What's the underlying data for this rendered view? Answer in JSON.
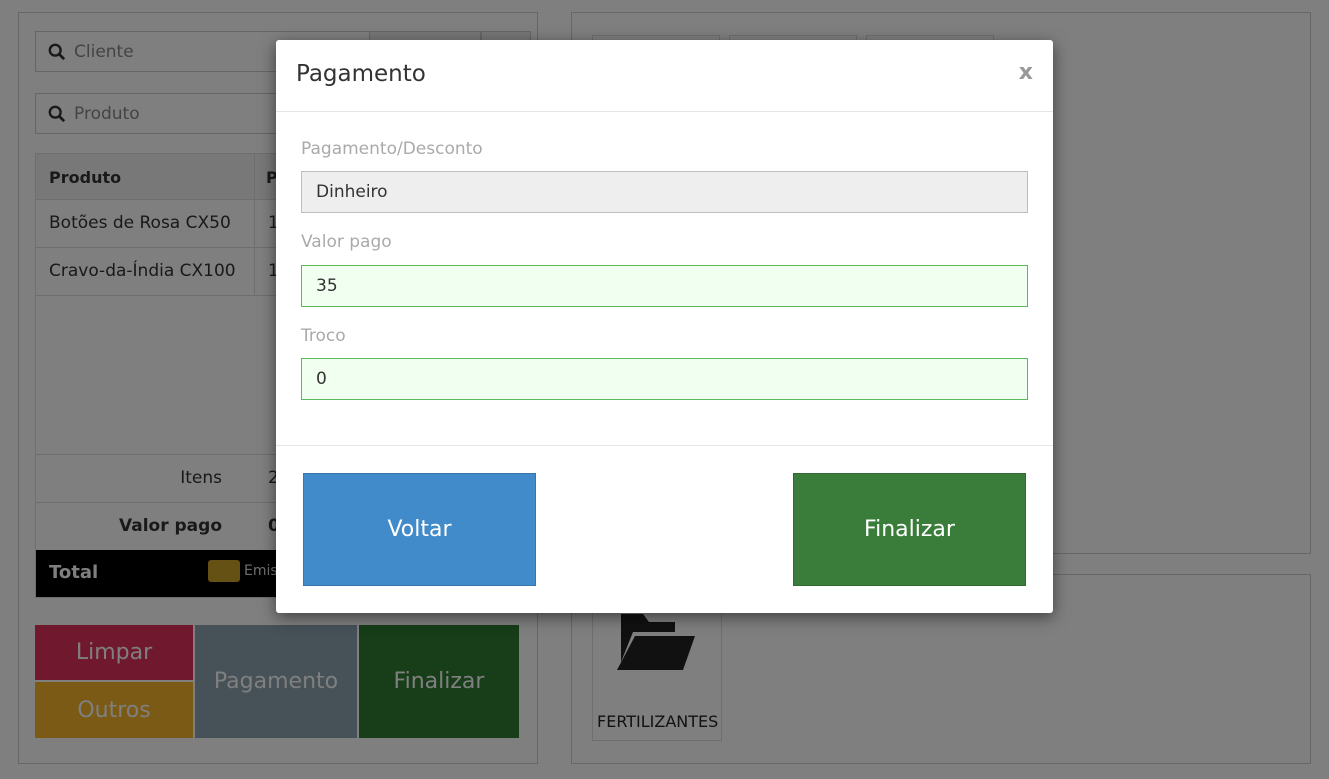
{
  "background": {
    "search": {
      "client_placeholder": "Cliente",
      "product_placeholder": "Produto"
    },
    "table": {
      "headers": [
        "Produto",
        "P"
      ],
      "rows": [
        {
          "produto": "Botões de Rosa CX50",
          "col2": "1"
        },
        {
          "produto": "Cravo-da-Índia CX100",
          "col2": "1"
        }
      ],
      "itens_label": "Itens",
      "itens_value": "2",
      "valor_pago_label": "Valor pago",
      "valor_pago_value": "0",
      "total_label": "Total",
      "emission_text": "Emis"
    },
    "buttons": {
      "limpar": "Limpar",
      "outros": "Outros",
      "pagamento": "Pagamento",
      "finalizar": "Finalizar"
    },
    "category": {
      "label": "FERTILIZANTES",
      "icon": "folder-open-icon"
    }
  },
  "modal": {
    "title": "Pagamento",
    "close_label": "x",
    "fields": {
      "payment_label": "Pagamento/Desconto",
      "payment_value": "Dinheiro",
      "paid_label": "Valor pago",
      "paid_value": "35",
      "change_label": "Troco",
      "change_value": "0"
    },
    "buttons": {
      "back": "Voltar",
      "finish": "Finalizar"
    }
  },
  "colors": {
    "overlay": "#000000",
    "back_button": "#428bca",
    "finish_button": "#3a7d3a",
    "valid_field_border": "#5cb85c"
  }
}
